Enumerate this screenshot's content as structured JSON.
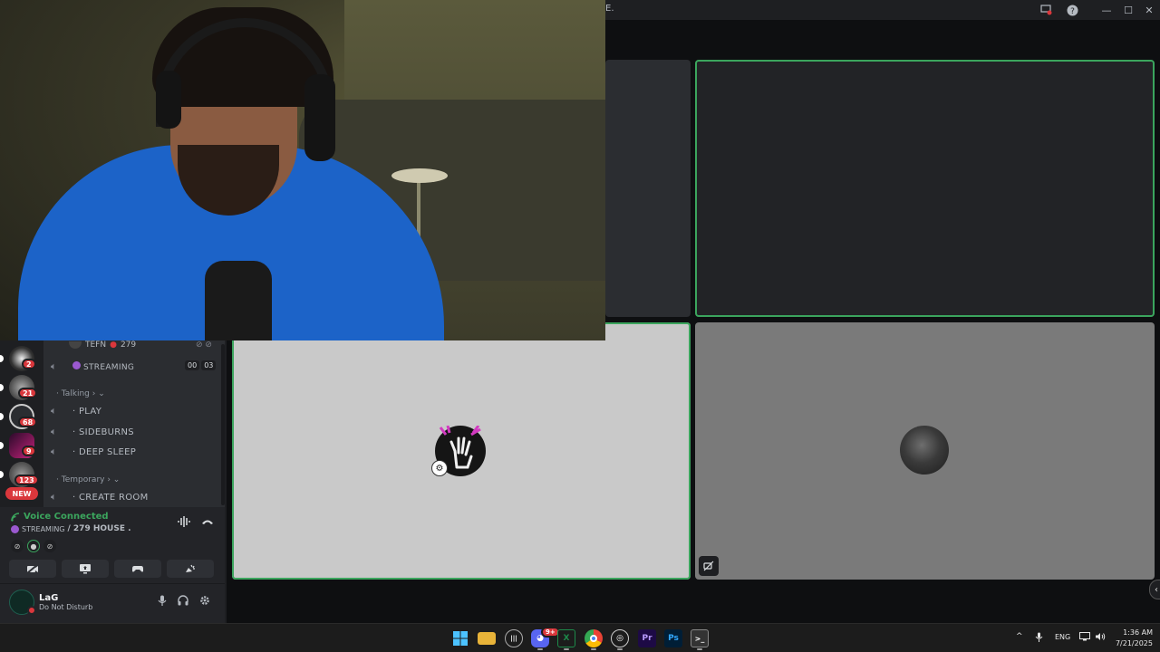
{
  "window": {
    "title_fragment": "E."
  },
  "channels": {
    "top_user": {
      "name": "TEFN",
      "count": "279"
    },
    "streaming_row": {
      "label": "STREAMING",
      "counter_a": "00",
      "counter_b": "03"
    },
    "categories": [
      {
        "label": "Talking ›",
        "items": [
          "PLAY",
          "SIDEBURNS",
          "DEEP SLEEP"
        ]
      },
      {
        "label": "Temporary ›",
        "items": [
          "CREATE ROOM"
        ]
      }
    ]
  },
  "servers": [
    {
      "badge": "2"
    },
    {
      "badge": "21"
    },
    {
      "badge": "68"
    },
    {
      "badge": "9"
    },
    {
      "badge": "123"
    }
  ],
  "new_badge": "NEW",
  "voice": {
    "title": "Voice Connected",
    "streaming_label": "STREAMING",
    "channel": "/ 279 HOUSE ."
  },
  "user": {
    "name": "LaG",
    "status": "Do Not Disturb"
  },
  "taskbar": {
    "discord_badge": "9+",
    "language": "ENG",
    "time": "1:36 AM",
    "date": "7/21/2025"
  },
  "colors": {
    "speaking": "#3ba55d",
    "dnd": "#da373c",
    "streaming": "#9b59d0"
  }
}
